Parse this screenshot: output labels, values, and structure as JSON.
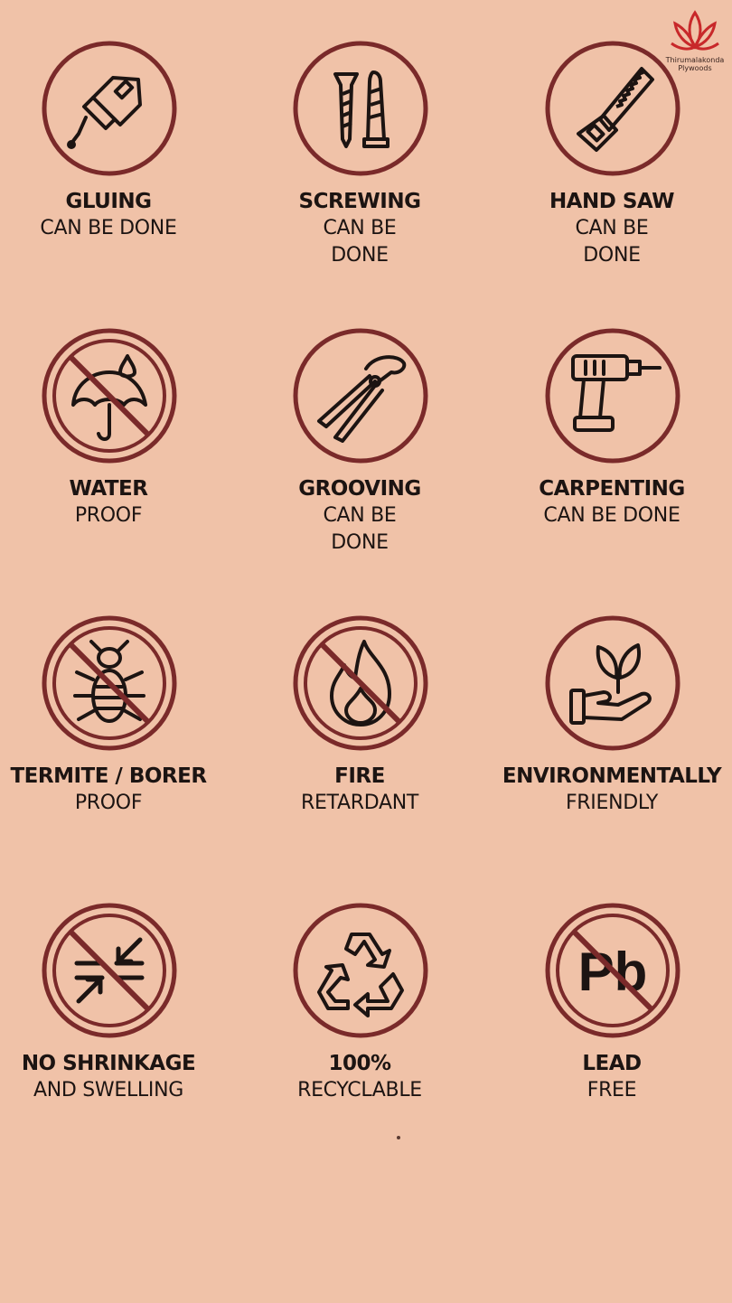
{
  "brand": {
    "line1": "Thirumalakonda",
    "line2": "Plywoods"
  },
  "colors": {
    "background": "#f0c2a8",
    "ring": "#7a2a2a",
    "icon": "#1c1412",
    "logo": "#c8282a"
  },
  "features": [
    {
      "title": "GLUING",
      "subtitle": "CAN BE DONE",
      "icon": "glue-tube-icon"
    },
    {
      "title": "SCREWING",
      "subtitle": "CAN BE DONE",
      "icon": "screws-icon"
    },
    {
      "title": "HAND SAW",
      "subtitle": "CAN BE DONE",
      "icon": "hand-saw-icon"
    },
    {
      "title": "WATER",
      "subtitle": "PROOF",
      "icon": "no-water-icon"
    },
    {
      "title": "GROOVING",
      "subtitle": "CAN BE DONE",
      "icon": "pliers-icon"
    },
    {
      "title": "CARPENTING",
      "subtitle": "CAN BE DONE",
      "icon": "drill-icon"
    },
    {
      "title": "TERMITE / BORER",
      "subtitle": "PROOF",
      "icon": "no-termite-icon"
    },
    {
      "title": "FIRE",
      "subtitle": "RETARDANT",
      "icon": "no-fire-icon"
    },
    {
      "title": "ENVIRONMENTALLY",
      "subtitle": "FRIENDLY",
      "icon": "plant-in-hand-icon"
    },
    {
      "title": "NO SHRINKAGE",
      "subtitle": "AND SWELLING",
      "icon": "no-shrink-icon"
    },
    {
      "title": "100%",
      "subtitle": "RECYCLABLE",
      "icon": "recycle-icon"
    },
    {
      "title": "LEAD",
      "subtitle": "FREE",
      "icon": "no-lead-icon"
    }
  ],
  "lead_symbol": "Pb"
}
